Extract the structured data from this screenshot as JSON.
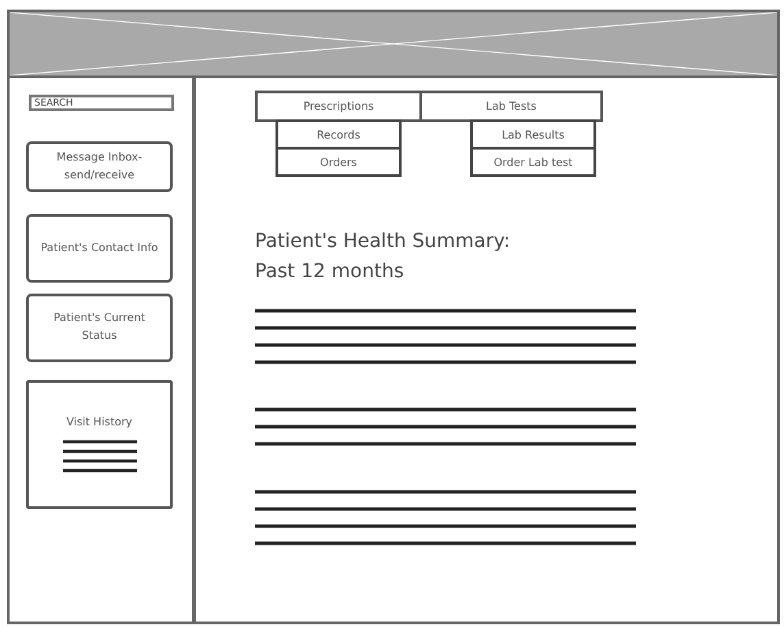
{
  "sidebar": {
    "search": {
      "placeholder": "SEARCH"
    },
    "cards": [
      {
        "kind": "text",
        "label": "Message Inbox-send/receive"
      },
      {
        "kind": "text",
        "label": "Patient's Contact Info"
      },
      {
        "kind": "text",
        "label": "Patient's Current Status"
      },
      {
        "kind": "list",
        "label": "Visit History"
      }
    ]
  },
  "menus": [
    {
      "label": "Prescriptions",
      "items": [
        "Records",
        "Orders"
      ]
    },
    {
      "label": "Lab Tests",
      "items": [
        "Lab Results",
        "Order Lab test"
      ]
    }
  ],
  "summary": {
    "title": [
      "Patient's Health Summary:",
      "Past 12 months"
    ]
  }
}
